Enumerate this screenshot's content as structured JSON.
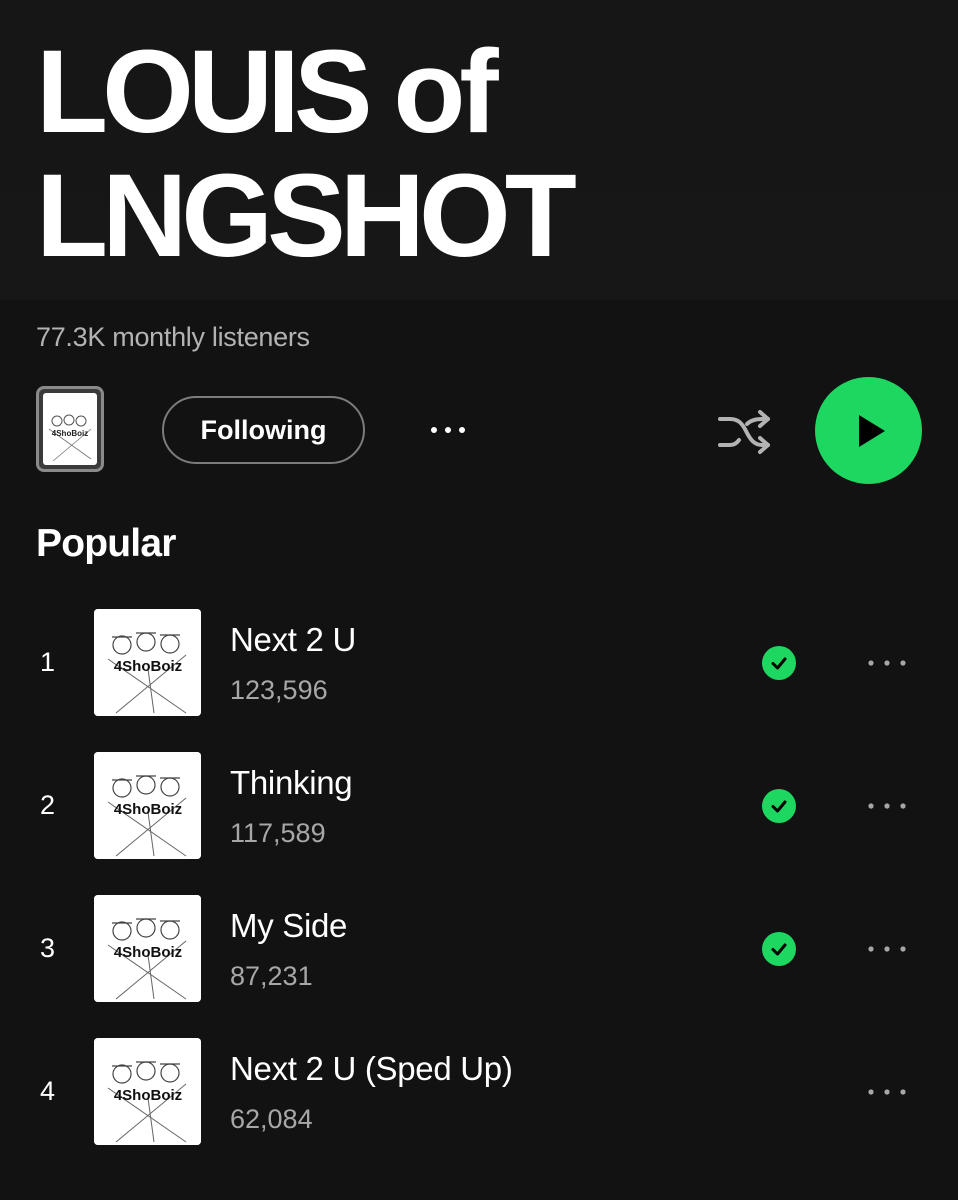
{
  "artist": {
    "name": "LOUIS of LNGSHOT",
    "monthly_listeners": "77.3K monthly listeners"
  },
  "actions": {
    "follow_label": "Following",
    "more_icon": "more-horizontal-icon",
    "shuffle_icon": "shuffle-icon",
    "play_icon": "play-icon",
    "cover_label": "4ShoBoiz"
  },
  "popular": {
    "heading": "Popular",
    "tracks": [
      {
        "rank": "1",
        "title": "Next 2 U",
        "plays": "123,596",
        "saved": true,
        "art_label": "4ShoBoiz"
      },
      {
        "rank": "2",
        "title": "Thinking",
        "plays": "117,589",
        "saved": true,
        "art_label": "4ShoBoiz"
      },
      {
        "rank": "3",
        "title": "My Side",
        "plays": "87,231",
        "saved": true,
        "art_label": "4ShoBoiz"
      },
      {
        "rank": "4",
        "title": "Next 2 U (Sped Up)",
        "plays": "62,084",
        "saved": false,
        "art_label": "4ShoBoiz"
      }
    ]
  },
  "colors": {
    "background": "#121212",
    "accent_green": "#1ed760",
    "secondary_text": "#b3b3b3"
  }
}
